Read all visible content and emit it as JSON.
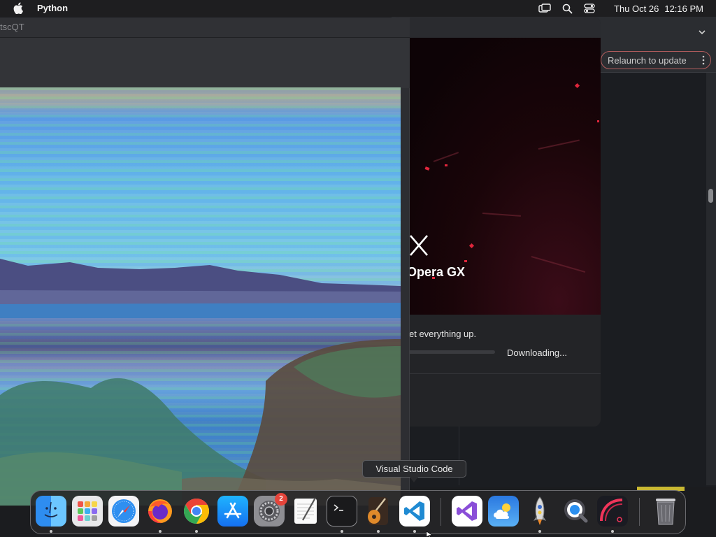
{
  "menubar": {
    "app_name": "Python",
    "date": "Thu Oct 26",
    "time": "12:16 PM"
  },
  "viewer_window": {
    "title_fragment": "tscQT"
  },
  "browser_window": {
    "relaunch_label": "Relaunch to update"
  },
  "installer": {
    "brand": "Opera GX",
    "message": "et everything up.",
    "status": "Downloading...",
    "progress": 0.0
  },
  "tooltip": {
    "text": "Visual Studio Code"
  },
  "dock": {
    "items": [
      {
        "name": "finder-icon",
        "running": true
      },
      {
        "name": "launchpad-icon",
        "running": false
      },
      {
        "name": "safari-icon",
        "running": false
      },
      {
        "name": "firefox-icon",
        "running": true
      },
      {
        "name": "chrome-icon",
        "running": true
      },
      {
        "name": "app-store-icon",
        "running": false
      },
      {
        "name": "system-settings-icon",
        "running": false,
        "badge": "2"
      },
      {
        "name": "textedit-icon",
        "running": false
      },
      {
        "name": "terminal-icon",
        "running": true
      },
      {
        "name": "garageband-icon",
        "running": true
      },
      {
        "name": "vscode-icon",
        "running": true
      },
      {
        "name": "visual-studio-icon",
        "running": false
      },
      {
        "name": "weather-icon",
        "running": false
      },
      {
        "name": "python-launcher-icon",
        "running": true
      },
      {
        "name": "quicktime-icon",
        "running": false
      },
      {
        "name": "opera-gx-installer-icon",
        "running": true
      },
      {
        "name": "trash-icon",
        "running": false
      }
    ]
  },
  "colors": {
    "menubar_bg": "#1e1e20",
    "opera_accent": "#e0263c",
    "relaunch_border": "#b35d5d"
  }
}
